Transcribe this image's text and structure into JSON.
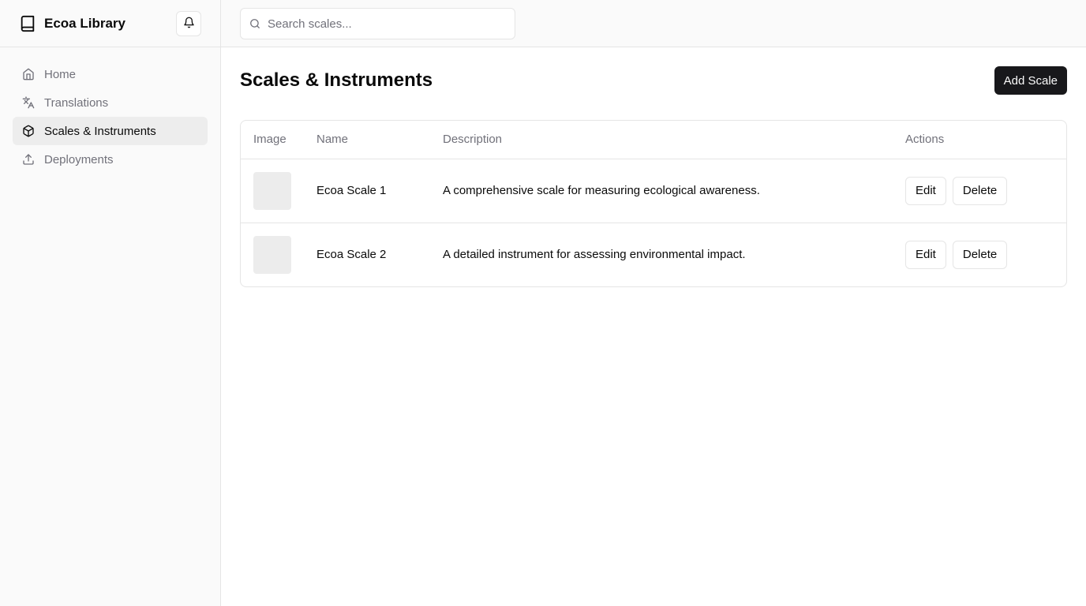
{
  "app": {
    "name": "Ecoa Library"
  },
  "icons": {
    "brand": "book-icon",
    "notifications": "bell-icon",
    "search": "search-icon"
  },
  "sidebar": {
    "items": [
      {
        "label": "Home",
        "icon": "home-icon",
        "active": false
      },
      {
        "label": "Translations",
        "icon": "languages-icon",
        "active": false
      },
      {
        "label": "Scales & Instruments",
        "icon": "package-icon",
        "active": true
      },
      {
        "label": "Deployments",
        "icon": "upload-icon",
        "active": false
      }
    ]
  },
  "search": {
    "placeholder": "Search scales...",
    "value": ""
  },
  "page": {
    "title": "Scales & Instruments",
    "add_button": "Add Scale"
  },
  "table": {
    "headers": {
      "image": "Image",
      "name": "Name",
      "description": "Description",
      "actions": "Actions"
    },
    "rows": [
      {
        "name": "Ecoa Scale 1",
        "description": "A comprehensive scale for measuring ecological awareness.",
        "edit": "Edit",
        "delete": "Delete"
      },
      {
        "name": "Ecoa Scale 2",
        "description": "A detailed instrument for assessing environmental impact.",
        "edit": "Edit",
        "delete": "Delete"
      }
    ]
  },
  "colors": {
    "primary_button": "#18181b",
    "active_nav_bg": "#ededed",
    "muted_text": "#71717a",
    "border": "#e5e5e5"
  }
}
